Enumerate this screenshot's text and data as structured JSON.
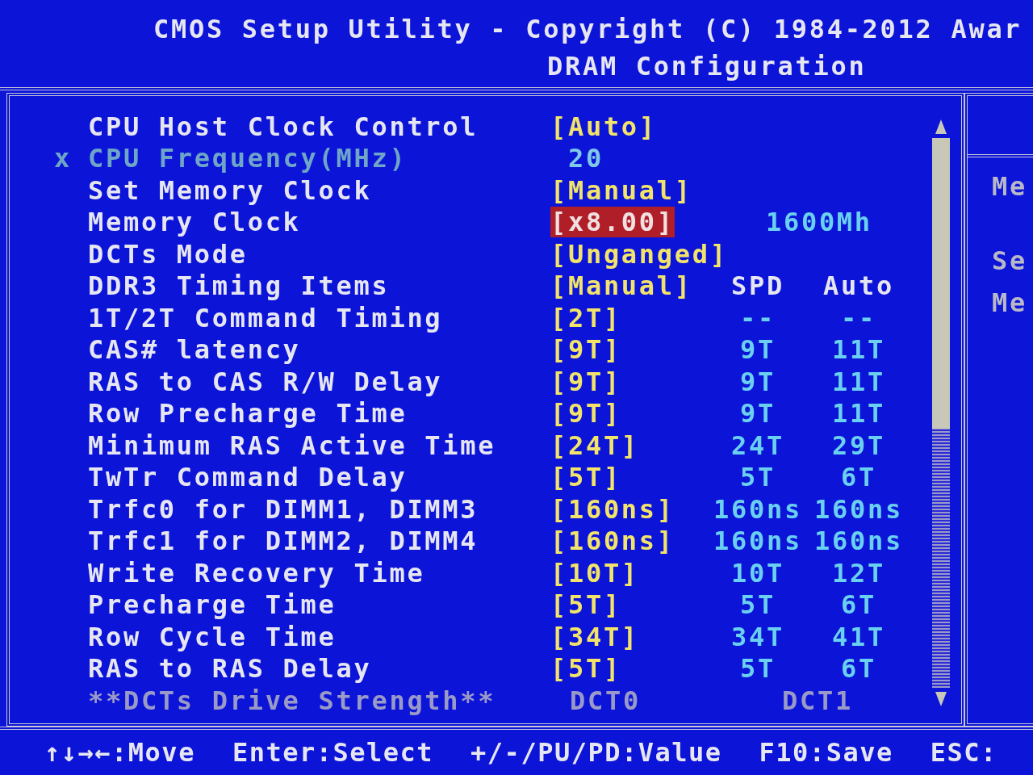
{
  "header": {
    "title": "CMOS Setup Utility - Copyright (C) 1984-2012 Awar",
    "subtitle": "DRAM Configuration"
  },
  "rows": [
    {
      "kind": "option",
      "label": "CPU Host Clock Control",
      "value": "[Auto]",
      "selected": false
    },
    {
      "kind": "locked",
      "marker": "x",
      "label": "CPU Frequency(MHz)",
      "value": "20",
      "selected": false
    },
    {
      "kind": "option",
      "label": "Set Memory Clock",
      "value": "[Manual]",
      "selected": false
    },
    {
      "kind": "option",
      "label": "Memory Clock",
      "value": "[x8.00]",
      "extra": "1600Mh",
      "selected": true
    },
    {
      "kind": "option",
      "label": "DCTs Mode",
      "value": "[Unganged]",
      "selected": false
    },
    {
      "kind": "option",
      "label": "DDR3 Timing Items",
      "value": "[Manual]",
      "spd": "SPD",
      "auto": "Auto",
      "selected": false
    },
    {
      "kind": "option",
      "label": "1T/2T Command Timing",
      "value": "[2T]",
      "spd": "--",
      "auto": "--",
      "selected": false
    },
    {
      "kind": "option",
      "label": "CAS# latency",
      "value": "[9T]",
      "spd": "9T",
      "auto": "11T",
      "selected": false
    },
    {
      "kind": "option",
      "label": "RAS to CAS R/W Delay",
      "value": "[9T]",
      "spd": "9T",
      "auto": "11T",
      "selected": false
    },
    {
      "kind": "option",
      "label": "Row Precharge Time",
      "value": "[9T]",
      "spd": "9T",
      "auto": "11T",
      "selected": false
    },
    {
      "kind": "option",
      "label": "Minimum RAS Active Time",
      "value": "[24T]",
      "spd": "24T",
      "auto": "29T",
      "selected": false
    },
    {
      "kind": "option",
      "label": "TwTr Command Delay",
      "value": "[5T]",
      "spd": "5T",
      "auto": "6T",
      "selected": false
    },
    {
      "kind": "option",
      "label": "Trfc0 for DIMM1, DIMM3",
      "value": "[160ns]",
      "spd": "160ns",
      "auto": "160ns",
      "selected": false
    },
    {
      "kind": "option",
      "label": "Trfc1 for DIMM2, DIMM4",
      "value": "[160ns]",
      "spd": "160ns",
      "auto": "160ns",
      "selected": false
    },
    {
      "kind": "option",
      "label": "Write Recovery Time",
      "value": "[10T]",
      "spd": "10T",
      "auto": "12T",
      "selected": false
    },
    {
      "kind": "option",
      "label": "Precharge Time",
      "value": "[5T]",
      "spd": "5T",
      "auto": "6T",
      "selected": false
    },
    {
      "kind": "option",
      "label": "Row Cycle Time",
      "value": "[34T]",
      "spd": "34T",
      "auto": "41T",
      "selected": false
    },
    {
      "kind": "option",
      "label": "RAS to RAS Delay",
      "value": "[5T]",
      "spd": "5T",
      "auto": "6T",
      "selected": false
    },
    {
      "kind": "heading",
      "label": "**DCTs Drive Strength**",
      "value": "DCT0",
      "spd": "DCT1",
      "selected": false
    }
  ],
  "help_panel": {
    "lines": [
      "Me",
      "Se",
      "Me"
    ]
  },
  "key_legend": [
    "↑↓→←:Move",
    "Enter:Select",
    "+/-/PU/PD:Value",
    "F10:Save",
    "ESC:"
  ]
}
